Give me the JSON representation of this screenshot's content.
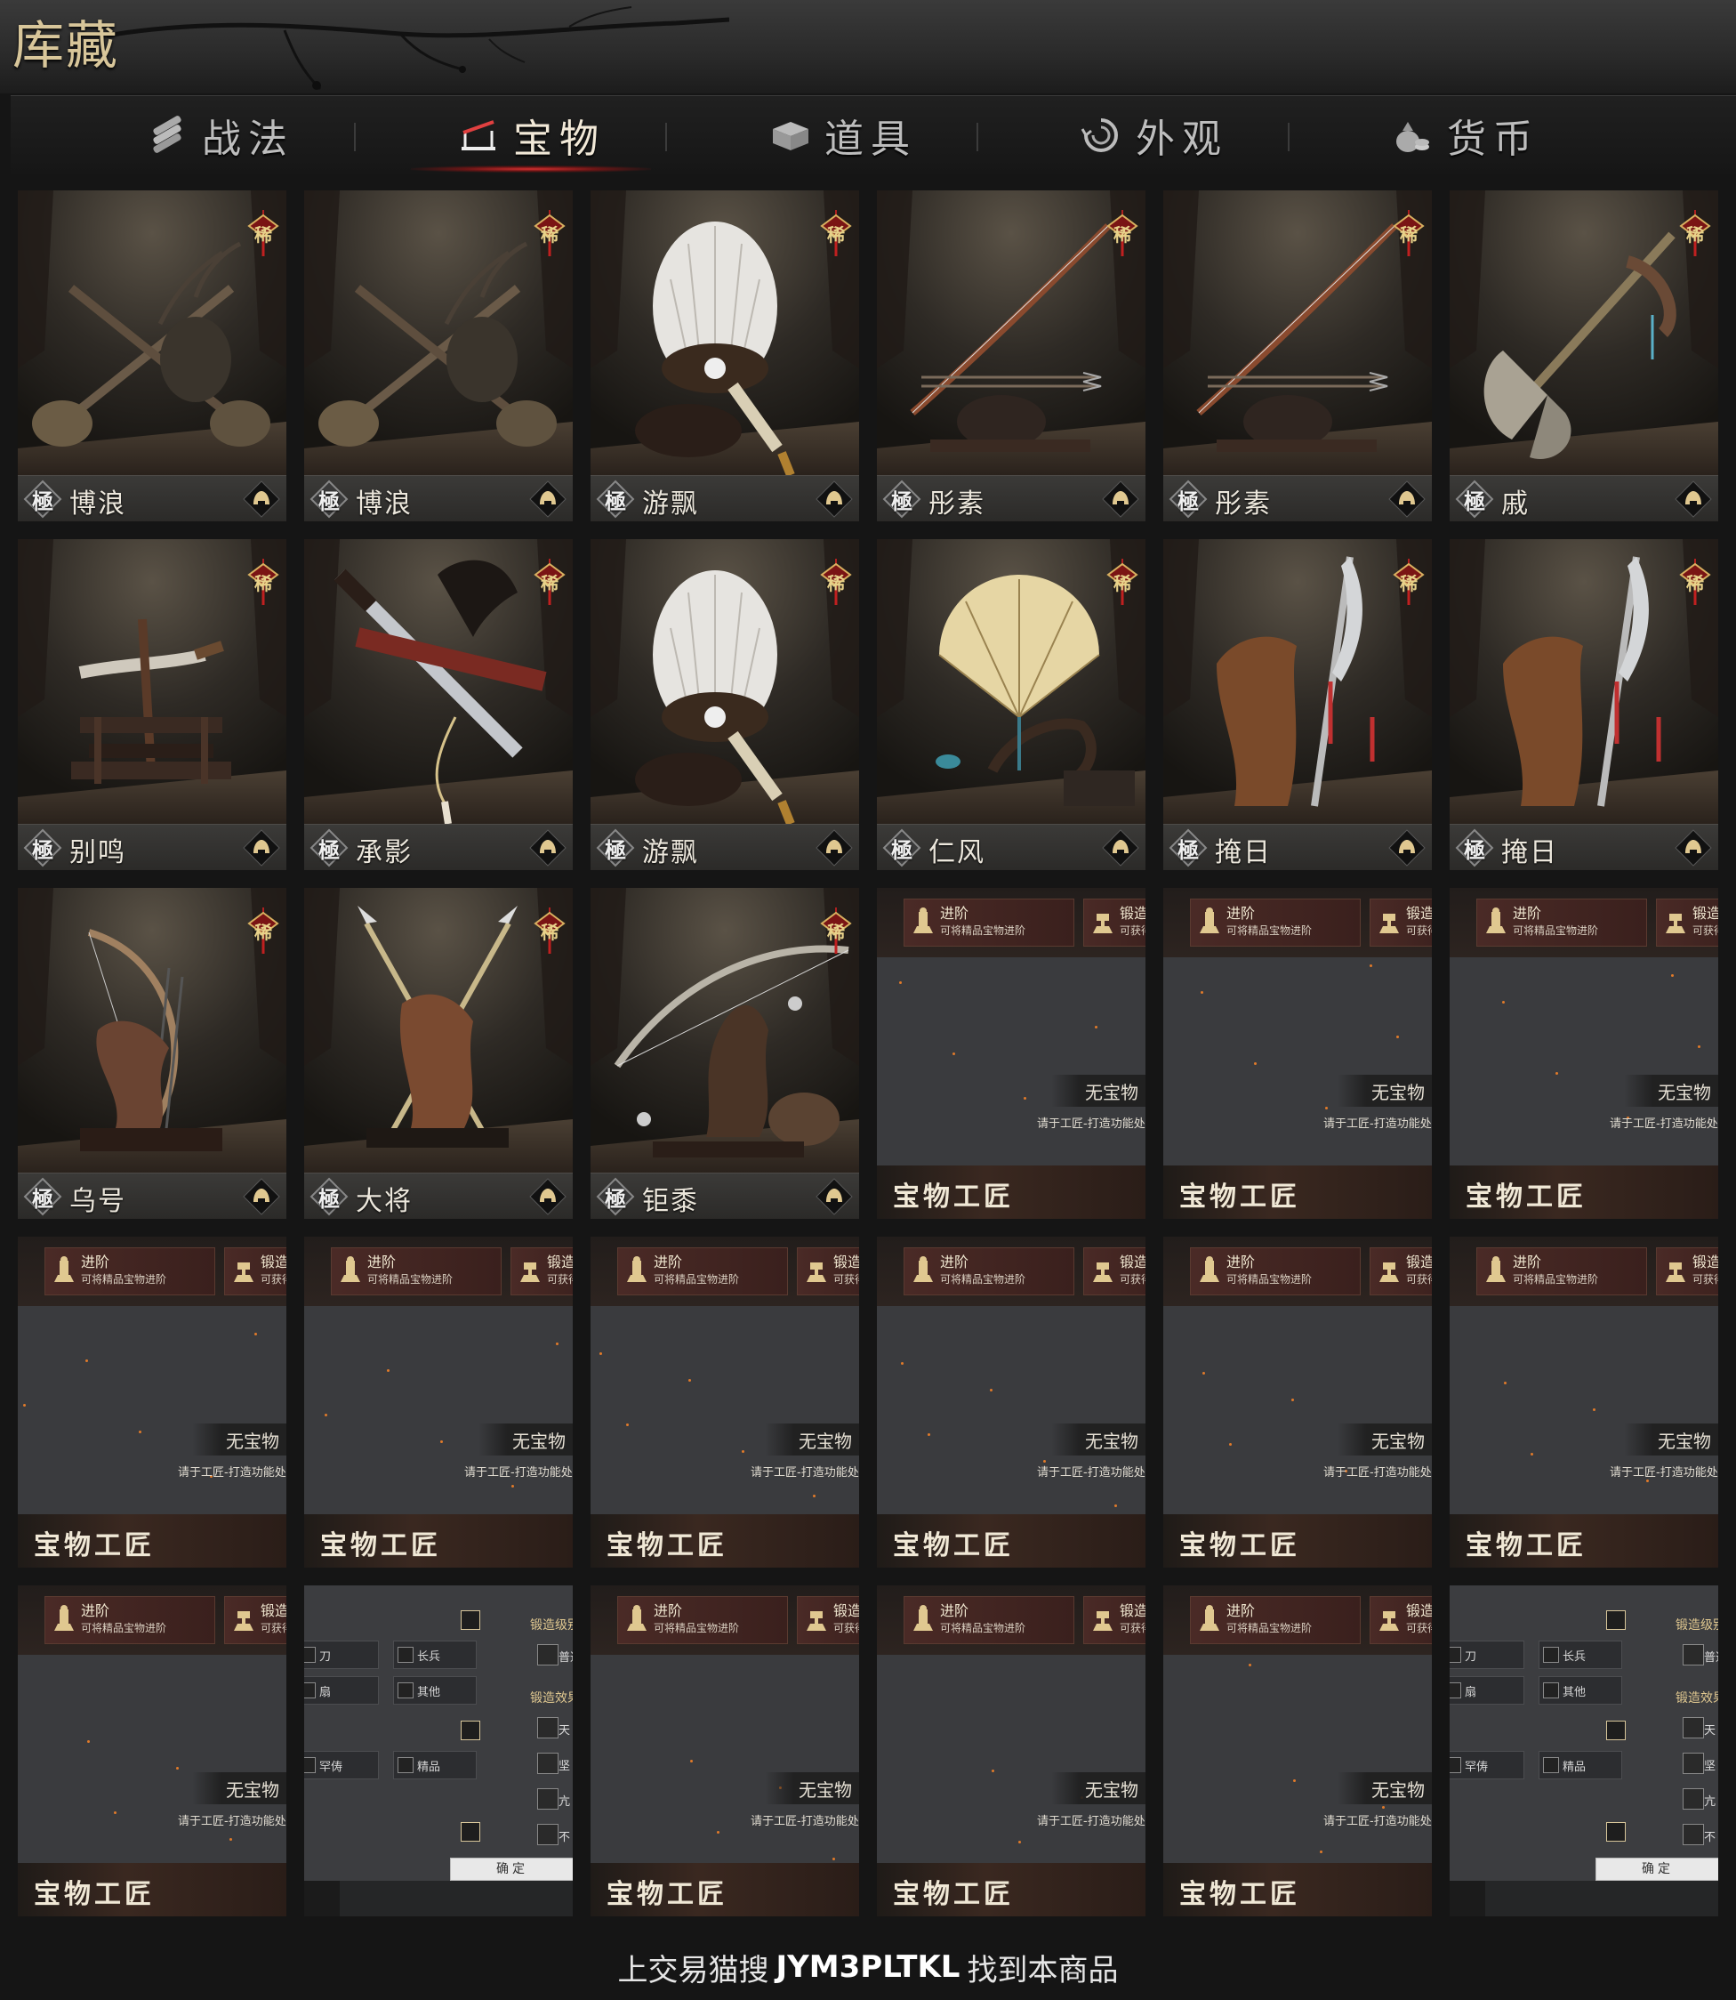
{
  "title": "库藏",
  "tabs": [
    {
      "label": "战法",
      "icon": "scroll-bundle-icon",
      "active": false
    },
    {
      "label": "宝物",
      "icon": "weapon-rack-icon",
      "active": true
    },
    {
      "label": "道具",
      "icon": "chest-icon",
      "active": false
    },
    {
      "label": "外观",
      "icon": "swirl-icon",
      "active": false
    },
    {
      "label": "货币",
      "icon": "money-bag-icon",
      "active": false
    }
  ],
  "quality_label": "極",
  "rare_badge": "稀",
  "treasures": [
    {
      "name": "博浪",
      "art": "crossed-maces"
    },
    {
      "name": "博浪",
      "art": "crossed-maces"
    },
    {
      "name": "游飘",
      "art": "feather-fan"
    },
    {
      "name": "彤素",
      "art": "bow"
    },
    {
      "name": "彤素",
      "art": "bow"
    },
    {
      "name": "戚",
      "art": "axe"
    },
    {
      "name": "别鸣",
      "art": "dagger"
    },
    {
      "name": "承影",
      "art": "sword"
    },
    {
      "name": "游飘",
      "art": "feather-fan"
    },
    {
      "name": "仁风",
      "art": "folding-fan"
    },
    {
      "name": "掩日",
      "art": "glaive"
    },
    {
      "name": "掩日",
      "art": "glaive"
    },
    {
      "name": "乌号",
      "art": "bow-stand"
    },
    {
      "name": "大将",
      "art": "crossed-spears"
    },
    {
      "name": "钜黍",
      "art": "crane-bow"
    }
  ],
  "craft_panel": {
    "advance_title": "进阶",
    "advance_desc": "可将精品宝物进阶",
    "forge_title": "锻造",
    "forge_desc": "可获得",
    "empty_title": "无宝物",
    "empty_hint": "请于工匠-打造功能处",
    "bottom_title": "宝物工匠"
  },
  "filter_panel": {
    "types": [
      "刀",
      "长兵",
      "扇",
      "其他"
    ],
    "grades": [
      "罕俦",
      "精品"
    ],
    "forge_level_label": "锻造级别",
    "forge_effect_label": "锻造效果",
    "side_options": [
      "普通",
      "天",
      "坚",
      "亢",
      "不"
    ],
    "confirm_label": "确定"
  },
  "layout_sequence": [
    "treasure",
    "treasure",
    "treasure",
    "treasure",
    "treasure",
    "treasure",
    "treasure",
    "treasure",
    "treasure",
    "treasure",
    "treasure",
    "treasure",
    "treasure",
    "treasure",
    "treasure",
    "craft",
    "craft",
    "craft",
    "craft",
    "craft",
    "craft",
    "craft",
    "craft",
    "craft",
    "craft",
    "filter",
    "craft",
    "craft",
    "craft",
    "filter"
  ],
  "footer": {
    "prefix": "上交易猫搜",
    "code": "JYM3PLTKL",
    "suffix": "找到本商品"
  }
}
